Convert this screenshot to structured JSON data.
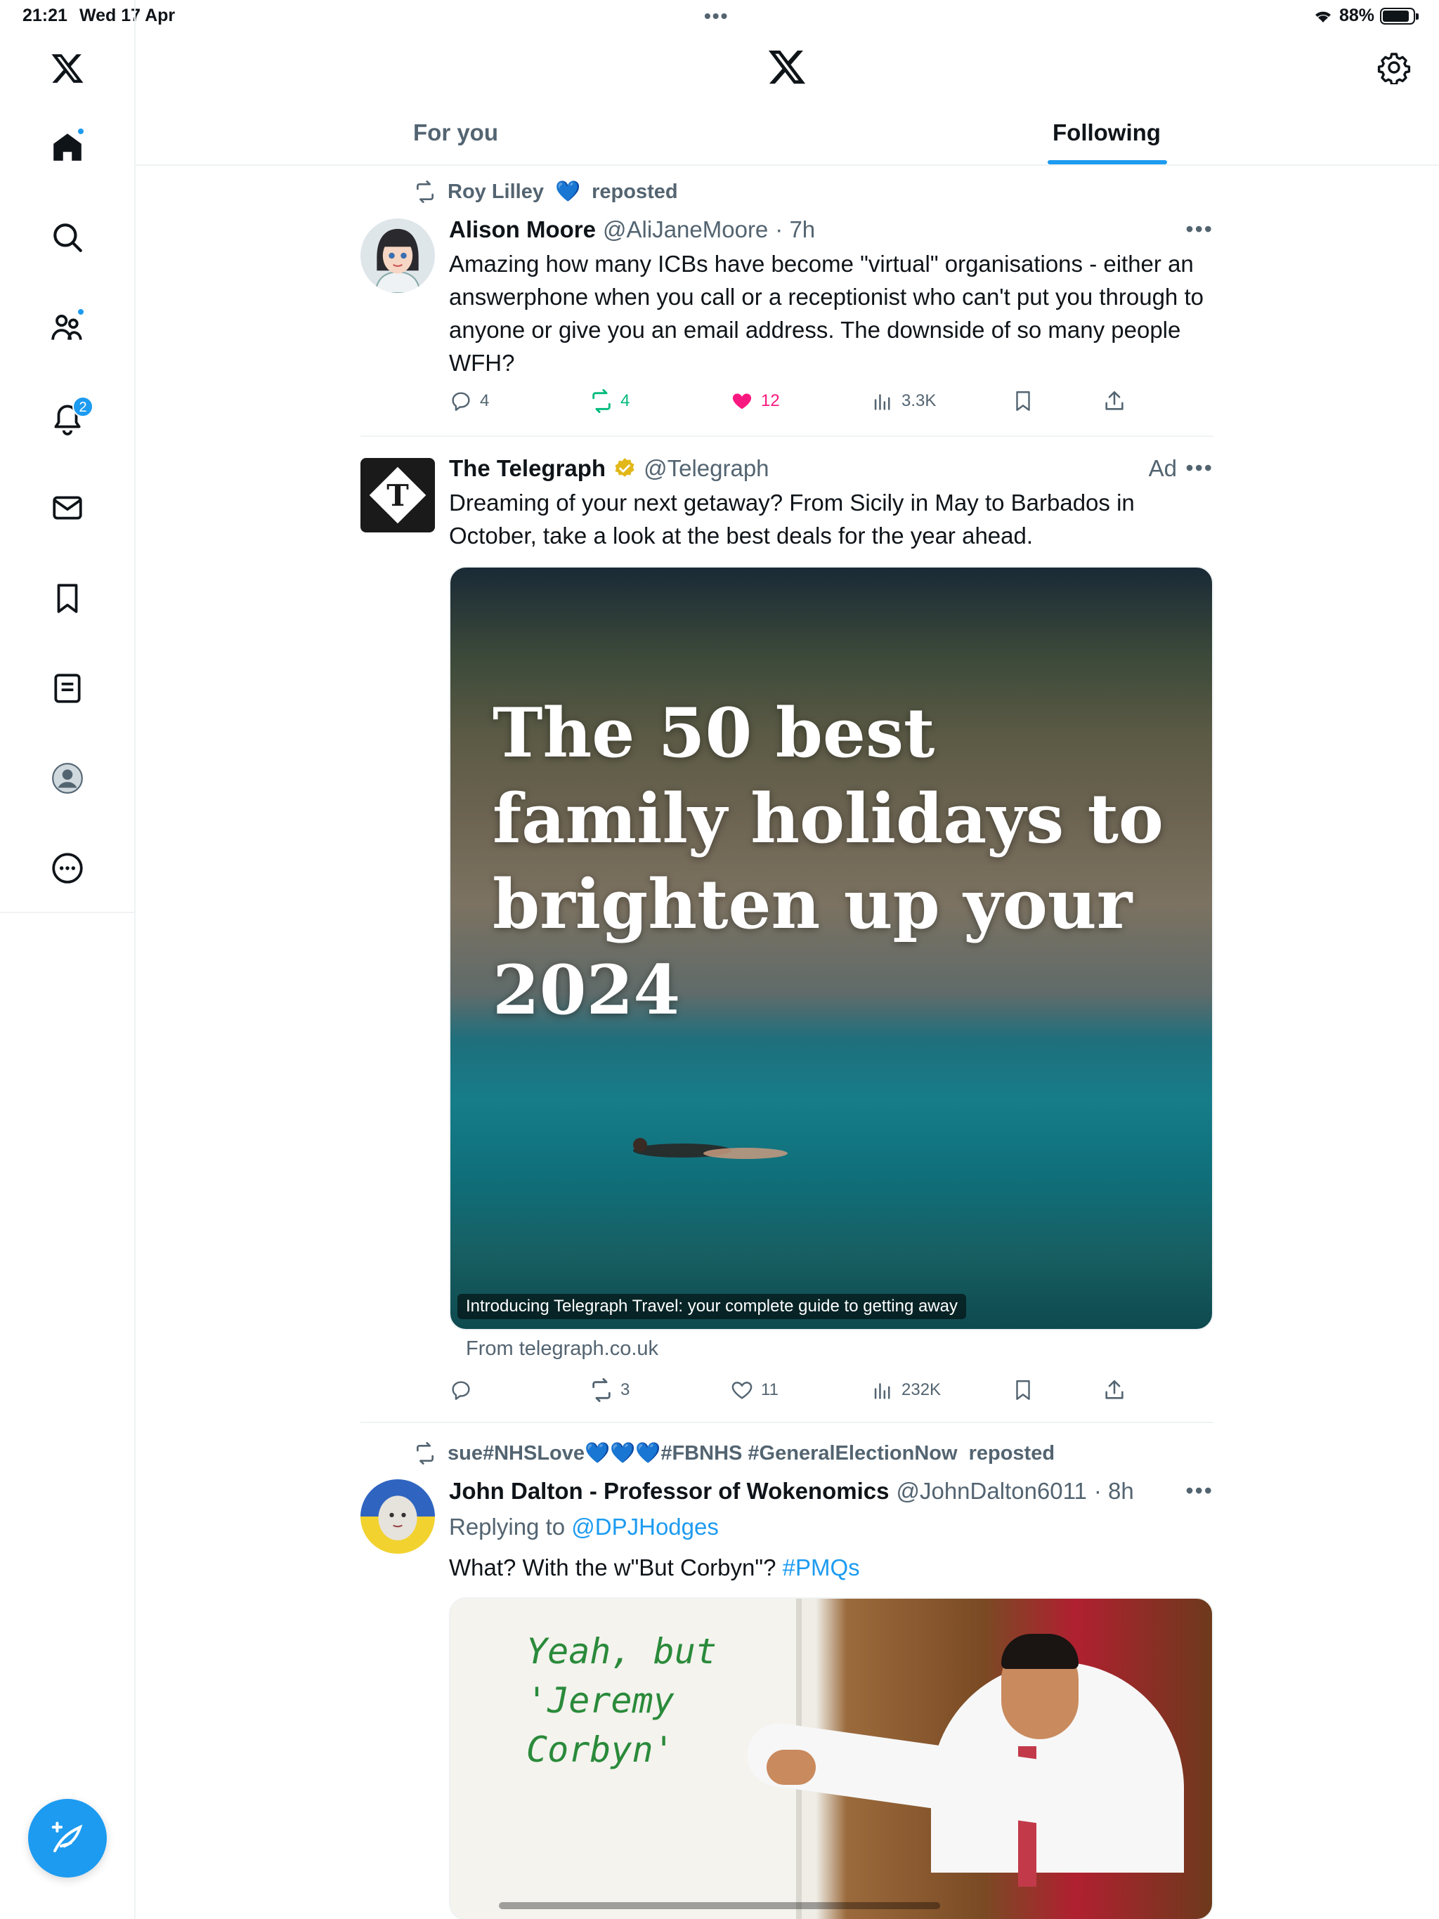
{
  "status": {
    "time": "21:21",
    "date": "Wed 17 Apr",
    "battery": "88%",
    "battery_level": 0.88
  },
  "sidebar": {
    "items": [
      {
        "id": "x-logo",
        "icon": "x-logo-icon"
      },
      {
        "id": "home",
        "icon": "home-icon",
        "dot": true
      },
      {
        "id": "search",
        "icon": "search-icon"
      },
      {
        "id": "communities",
        "icon": "communities-icon",
        "dot": true
      },
      {
        "id": "notifications",
        "icon": "bell-icon",
        "badge": "2"
      },
      {
        "id": "messages",
        "icon": "mail-icon"
      },
      {
        "id": "bookmarks",
        "icon": "bookmark-icon"
      },
      {
        "id": "lists",
        "icon": "list-icon"
      },
      {
        "id": "profile",
        "icon": "avatar-icon"
      },
      {
        "id": "more",
        "icon": "more-icon"
      }
    ],
    "compose_icon": "compose-feather-icon"
  },
  "header": {
    "tabs": [
      {
        "label": "For you",
        "active": false
      },
      {
        "label": "Following",
        "active": true
      }
    ]
  },
  "feed": {
    "posts": [
      {
        "repost_by": "Roy Lilley",
        "repost_emoji": "💙",
        "repost_suffix": "reposted",
        "name": "Alison Moore",
        "handle": "@AliJaneMoore",
        "time": "· 7h",
        "text": "Amazing how many ICBs have become \"virtual\" organisations - either an answerphone when you call or a receptionist who can't put you through to anyone or give you an email address. The downside of so many people WFH?",
        "actions": {
          "replies": "4",
          "reposts": "4",
          "likes": "12",
          "views": "3.3K"
        }
      },
      {
        "name": "The Telegraph",
        "handle": "@Telegraph",
        "ad_label": "Ad",
        "text": "Dreaming of your next getaway? From Sicily in May to Barbados in October, take a look at the best deals for the year ahead.",
        "media_title": "The 50 best family holidays to brighten up your 2024",
        "media_caption": "Introducing Telegraph Travel: your complete guide to getting away",
        "from": "From telegraph.co.uk",
        "actions": {
          "replies": "",
          "reposts": "3",
          "likes": "11",
          "views": "232K"
        }
      },
      {
        "repost_by": "sue#NHSLove💙💙💙#FBNHS #GeneralElectionNow",
        "repost_suffix": "reposted",
        "name": "John Dalton - Professor of Wokenomics",
        "handle": "@JohnDalton6011",
        "time": "· 8h",
        "replying_to_label": "Replying to",
        "replying_to": "@DPJHodges",
        "text": "What?  With the w\"But Corbyn\"?",
        "hashtag": "#PMQs",
        "meme_lines": [
          "Yeah, but",
          "'Jeremy",
          "Corbyn'"
        ]
      }
    ]
  },
  "colors": {
    "accent": "#1d9bf0",
    "like": "#f91880",
    "repost": "#00ba7c",
    "muted": "#536471"
  }
}
